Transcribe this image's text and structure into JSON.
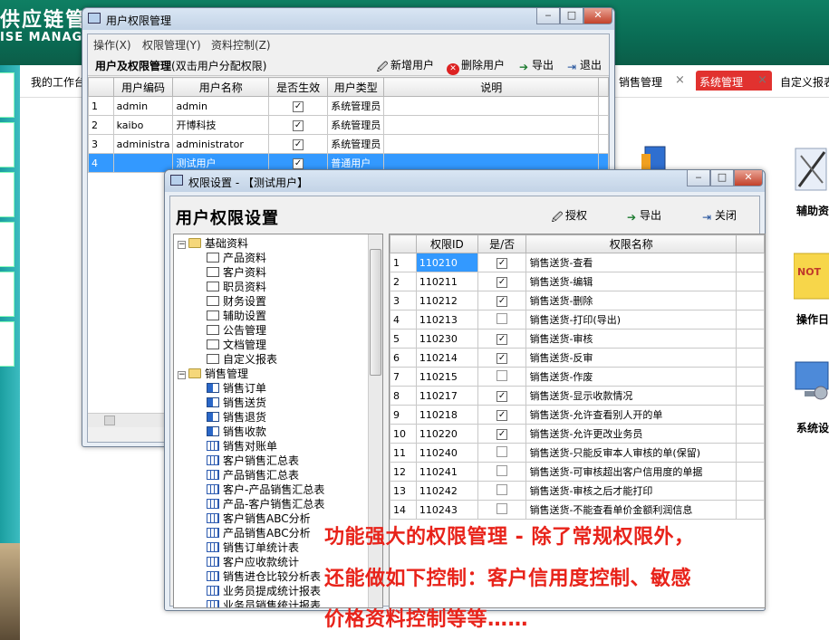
{
  "app": {
    "title": "供应链管",
    "subtitle": "ISE MANAGE",
    "tabs": {
      "workspace": "我的工作台",
      "sales_mgmt": "销售管理",
      "system_mgmt": "系统管理",
      "custom_report": "自定义报表",
      "close_glyph": "×"
    },
    "desktop": {
      "assist": "辅助资",
      "operation": "操作日",
      "system": "系统设"
    },
    "colors": {
      "header": "#0f7f63",
      "active_tab": "#e1322f",
      "selection": "#3399ff",
      "promo": "#e8231a"
    }
  },
  "user_window": {
    "title": "用户权限管理",
    "menu": [
      "操作(X)",
      "权限管理(Y)",
      "资料控制(Z)"
    ],
    "caption": "用户及权限管理",
    "caption_hint": "(双击用户分配权限)",
    "buttons": {
      "add": "新增用户",
      "delete": "删除用户",
      "export": "导出",
      "exit": "退出"
    },
    "columns": [
      "",
      "用户编码",
      "用户名称",
      "是否生效",
      "用户类型",
      "说明"
    ],
    "rows": [
      {
        "no": "1",
        "code": "admin",
        "name": "admin",
        "active": true,
        "type": "系统管理员",
        "note": ""
      },
      {
        "no": "2",
        "code": "kaibo",
        "name": "开博科技",
        "active": true,
        "type": "系统管理员",
        "note": ""
      },
      {
        "no": "3",
        "code": "administra",
        "name": "administrator",
        "active": true,
        "type": "系统管理员",
        "note": ""
      },
      {
        "no": "4",
        "code": "",
        "name": "测试用户",
        "active": true,
        "type": "普通用户",
        "note": "",
        "selected": true
      }
    ]
  },
  "perm_window": {
    "title": "权限设置 - 【测试用户】",
    "heading": "用户权限设置",
    "buttons": {
      "grant": "授权",
      "export": "导出",
      "close": "关闭"
    },
    "tree": [
      {
        "label": "基础资料",
        "level": 0,
        "icon": "folder-icon"
      },
      {
        "label": "产品资料",
        "level": 1,
        "icon": "doc-icon"
      },
      {
        "label": "客户资料",
        "level": 1,
        "icon": "doc-icon"
      },
      {
        "label": "职员资料",
        "level": 1,
        "icon": "doc-icon"
      },
      {
        "label": "财务设置",
        "level": 1,
        "icon": "doc-icon"
      },
      {
        "label": "辅助设置",
        "level": 1,
        "icon": "doc-icon"
      },
      {
        "label": "公告管理",
        "level": 1,
        "icon": "doc-icon"
      },
      {
        "label": "文档管理",
        "level": 1,
        "icon": "doc-icon"
      },
      {
        "label": "自定义报表",
        "level": 1,
        "icon": "doc-icon"
      },
      {
        "label": "销售管理",
        "level": 0,
        "icon": "folder-icon"
      },
      {
        "label": "销售订单",
        "level": 1,
        "icon": "flow-icon"
      },
      {
        "label": "销售送货",
        "level": 1,
        "icon": "flow-icon"
      },
      {
        "label": "销售退货",
        "level": 1,
        "icon": "flow-icon"
      },
      {
        "label": "销售收款",
        "level": 1,
        "icon": "flow-icon"
      },
      {
        "label": "销售对账单",
        "level": 1,
        "icon": "table-icon"
      },
      {
        "label": "客户销售汇总表",
        "level": 1,
        "icon": "table-icon"
      },
      {
        "label": "产品销售汇总表",
        "level": 1,
        "icon": "table-icon"
      },
      {
        "label": "客户-产品销售汇总表",
        "level": 1,
        "icon": "table-icon"
      },
      {
        "label": "产品-客户销售汇总表",
        "level": 1,
        "icon": "table-icon"
      },
      {
        "label": "客户销售ABC分析",
        "level": 1,
        "icon": "table-icon"
      },
      {
        "label": "产品销售ABC分析",
        "level": 1,
        "icon": "table-icon"
      },
      {
        "label": "销售订单统计表",
        "level": 1,
        "icon": "table-icon"
      },
      {
        "label": "客户应收款统计",
        "level": 1,
        "icon": "table-icon"
      },
      {
        "label": "销售进仓比较分析表",
        "level": 1,
        "icon": "table-icon"
      },
      {
        "label": "业务员提成统计报表",
        "level": 1,
        "icon": "table-icon"
      },
      {
        "label": "业务员销售统计报表",
        "level": 1,
        "icon": "table-icon"
      }
    ],
    "columns": [
      "",
      "权限ID",
      "是/否",
      "权限名称"
    ],
    "rows": [
      {
        "no": "1",
        "id": "110210",
        "on": true,
        "name": "销售送货-查看"
      },
      {
        "no": "2",
        "id": "110211",
        "on": true,
        "name": "销售送货-编辑"
      },
      {
        "no": "3",
        "id": "110212",
        "on": true,
        "name": "销售送货-删除"
      },
      {
        "no": "4",
        "id": "110213",
        "on": false,
        "name": "销售送货-打印(导出)"
      },
      {
        "no": "5",
        "id": "110230",
        "on": true,
        "name": "销售送货-审核"
      },
      {
        "no": "6",
        "id": "110214",
        "on": true,
        "name": "销售送货-反审"
      },
      {
        "no": "7",
        "id": "110215",
        "on": false,
        "name": "销售送货-作废"
      },
      {
        "no": "8",
        "id": "110217",
        "on": true,
        "name": "销售送货-显示收款情况"
      },
      {
        "no": "9",
        "id": "110218",
        "on": true,
        "name": "销售送货-允许查看别人开的单"
      },
      {
        "no": "10",
        "id": "110220",
        "on": true,
        "name": "销售送货-允许更改业务员"
      },
      {
        "no": "11",
        "id": "110240",
        "on": false,
        "name": "销售送货-只能反审本人审核的单(保留)"
      },
      {
        "no": "12",
        "id": "110241",
        "on": false,
        "name": "销售送货-可审核超出客户信用度的单据"
      },
      {
        "no": "13",
        "id": "110242",
        "on": false,
        "name": "销售送货-审核之后才能打印"
      },
      {
        "no": "14",
        "id": "110243",
        "on": false,
        "name": "销售送货-不能查看单价金额利润信息"
      }
    ]
  },
  "promo": {
    "line1": "功能强大的权限管理 - 除了常规权限外，",
    "line2": "还能做如下控制：客户信用度控制、敏感",
    "line3": "价格资料控制等等……"
  }
}
